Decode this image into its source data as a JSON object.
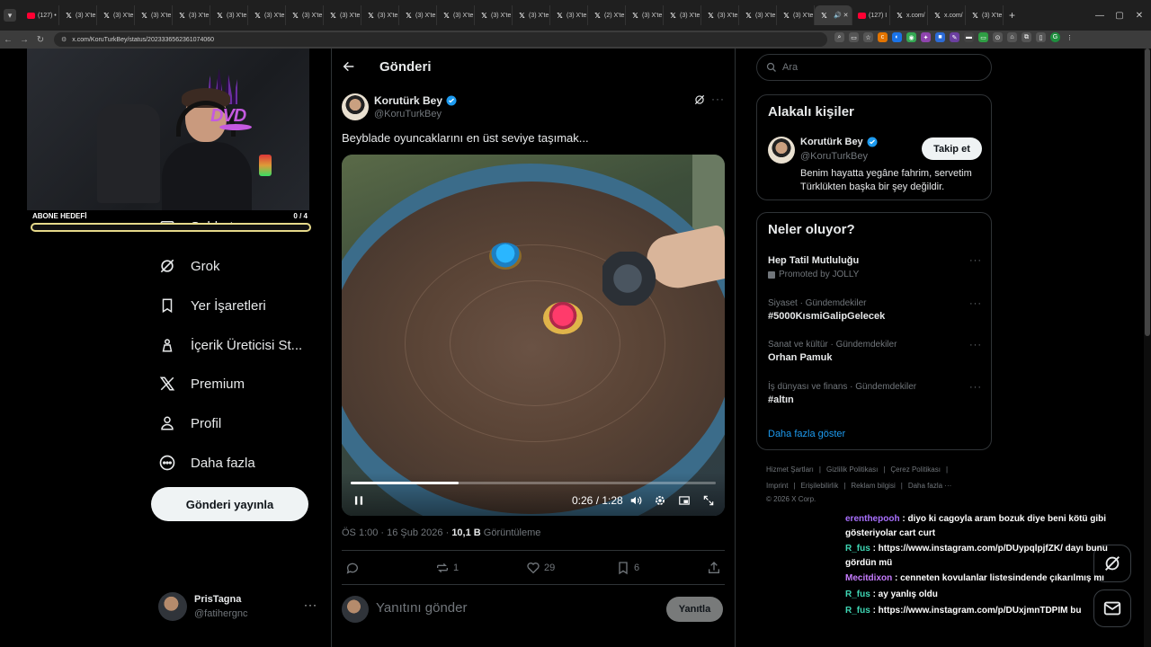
{
  "browser": {
    "tabs": [
      {
        "title": "(127) •",
        "fav": "yt"
      },
      {
        "title": "(3) X'te",
        "fav": "x"
      },
      {
        "title": "(3) X'te",
        "fav": "x"
      },
      {
        "title": "(3) X'te",
        "fav": "x"
      },
      {
        "title": "(3) X'te",
        "fav": "x"
      },
      {
        "title": "(3) X'te",
        "fav": "x"
      },
      {
        "title": "(3) X'te",
        "fav": "x"
      },
      {
        "title": "(3) X'te",
        "fav": "x"
      },
      {
        "title": "(3) X'te",
        "fav": "x"
      },
      {
        "title": "(3) X'te",
        "fav": "x"
      },
      {
        "title": "(3) X'te",
        "fav": "x"
      },
      {
        "title": "(3) X'te",
        "fav": "x"
      },
      {
        "title": "(3) X'te",
        "fav": "x"
      },
      {
        "title": "(3) X'te",
        "fav": "x"
      },
      {
        "title": "(3) X'te",
        "fav": "x"
      },
      {
        "title": "(2) X'te",
        "fav": "x"
      },
      {
        "title": "(3) X'te",
        "fav": "x"
      },
      {
        "title": "(3) X'te",
        "fav": "x"
      },
      {
        "title": "(3) X'te",
        "fav": "x"
      },
      {
        "title": "(3) X'te",
        "fav": "x"
      },
      {
        "title": "(3) X'te",
        "fav": "x"
      },
      {
        "title": "",
        "fav": "x",
        "active": true
      },
      {
        "title": "(127) I",
        "fav": "yt"
      },
      {
        "title": "x.com/",
        "fav": "x"
      },
      {
        "title": "x.com/",
        "fav": "x"
      },
      {
        "title": "(3) X'te",
        "fav": "x"
      }
    ],
    "url": "x.com/KoruTurkBey/status/2023336562361074060"
  },
  "stream": {
    "sub_goal_label": "ABONE HEDEFİ",
    "sub_goal_count": "0 / 4",
    "sub_goal_progress": 0
  },
  "nav": {
    "items": [
      {
        "label": "Sohbet",
        "icon": "mail-icon"
      },
      {
        "label": "Grok",
        "icon": "grok-icon"
      },
      {
        "label": "Yer İşaretleri",
        "icon": "bookmark-icon"
      },
      {
        "label": "İçerik Üreticisi St...",
        "icon": "creator-studio-icon"
      },
      {
        "label": "Premium",
        "icon": "x-logo-icon"
      },
      {
        "label": "Profil",
        "icon": "profile-icon"
      },
      {
        "label": "Daha fazla",
        "icon": "more-circle-icon"
      }
    ],
    "post_button": "Gönderi yayınla",
    "account": {
      "name": "PrisTagna",
      "handle": "@fatihergnc"
    }
  },
  "post": {
    "header_title": "Gönderi",
    "author_name": "Korutürk Bey",
    "author_handle": "@KoruTurkBey",
    "text": "Beyblade oyuncaklarını en üst seviye taşımak...",
    "video": {
      "time": "0:26 / 1:28",
      "progress": 0.295
    },
    "timestamp": "ÖS 1:00 · 16 Şub 2026 · ",
    "views": "10,1 B",
    "views_label": " Görüntüleme",
    "actions": {
      "replies": "",
      "reposts": "1",
      "likes": "29",
      "bookmarks": "6"
    },
    "reply_placeholder": "Yanıtını gönder",
    "reply_button": "Yanıtla"
  },
  "sidebar": {
    "search_placeholder": "Ara",
    "related_title": "Alakalı kişiler",
    "related": {
      "name": "Korutürk Bey",
      "handle": "@KoruTurkBey",
      "bio": "Benim hayatta yegâne fahrim, servetim Türklükten başka bir şey değildir.",
      "follow": "Takip et"
    },
    "trends_title": "Neler oluyor?",
    "trends": [
      {
        "category": "",
        "title": "Hep Tatil Mutluluğu",
        "promo": "Promoted by JOLLY"
      },
      {
        "category": "Siyaset · Gündemdekiler",
        "title": "#5000KısmiGalipGelecek",
        "promo": ""
      },
      {
        "category": "Sanat ve kültür · Gündemdekiler",
        "title": "Orhan Pamuk",
        "promo": ""
      },
      {
        "category": "İş dünyası ve finans · Gündemdekiler",
        "title": "#altın",
        "promo": ""
      }
    ],
    "show_more": "Daha fazla göster",
    "footer": {
      "row1": [
        "Hizmet Şartları",
        "Gizlilik Politikası",
        "Çerez Politikası"
      ],
      "row2": [
        "Imprint",
        "Erişilebilirlik",
        "Reklam bilgisi",
        "Daha fazla ···"
      ],
      "copyright": "© 2026 X Corp."
    }
  },
  "chat": [
    {
      "user": "erenthepooh",
      "color": "#a970ff",
      "text": " : diyo ki cagoyla aram bozuk diye beni kötü gibi gösteriyolar cart curt"
    },
    {
      "user": "R_fus",
      "color": "#3fd6b4",
      "text": " : https://www.instagram.com/p/DUypqlpjfZK/ dayı bunu gördün mü"
    },
    {
      "user": "Mecitdixon",
      "color": "#c77dff",
      "text": " : cenneten kovulanlar listesindende çıkarılmış mı"
    },
    {
      "user": "R_fus",
      "color": "#3fd6b4",
      "text": " : ay yanlış oldu"
    },
    {
      "user": "R_fus",
      "color": "#3fd6b4",
      "text": " : https://www.instagram.com/p/DUxjmnTDPIM bu"
    }
  ]
}
